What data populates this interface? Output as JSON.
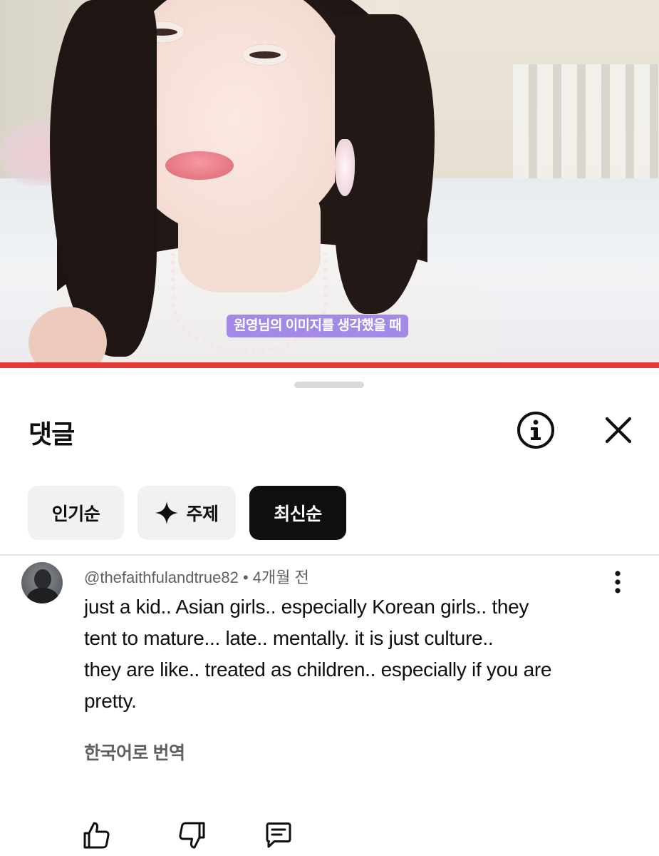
{
  "video": {
    "subtitle": "원영님의 이미지를 생각했을 때"
  },
  "comments_panel": {
    "title": "댓글",
    "icons": {
      "info": "info-circle-icon",
      "close": "close-icon"
    },
    "sort_chips": [
      {
        "label": "인기순",
        "selected": false
      },
      {
        "label": "주제",
        "icon": "sparkle-icon",
        "selected": false
      },
      {
        "label": "최신순",
        "selected": true
      }
    ],
    "comment": {
      "author": "@thefaithfulandtrue82",
      "separator": "•",
      "time": "4개월 전",
      "lines": [
        "just a kid.. Asian girls.. especially Korean girls.. they",
        "tent to mature... late.. mentally. it is just culture..",
        "they are like.. treated as children.. especially if you are",
        "pretty."
      ],
      "translate_label": "한국어로 번역",
      "actions": [
        "like-icon",
        "dislike-icon",
        "reply-icon"
      ]
    }
  },
  "colors": {
    "progress_bar": "#e53935",
    "selected_chip": "#0f0f0f",
    "chip_bg": "#f1f1f1",
    "subtitle_bg": "#9678e6"
  }
}
